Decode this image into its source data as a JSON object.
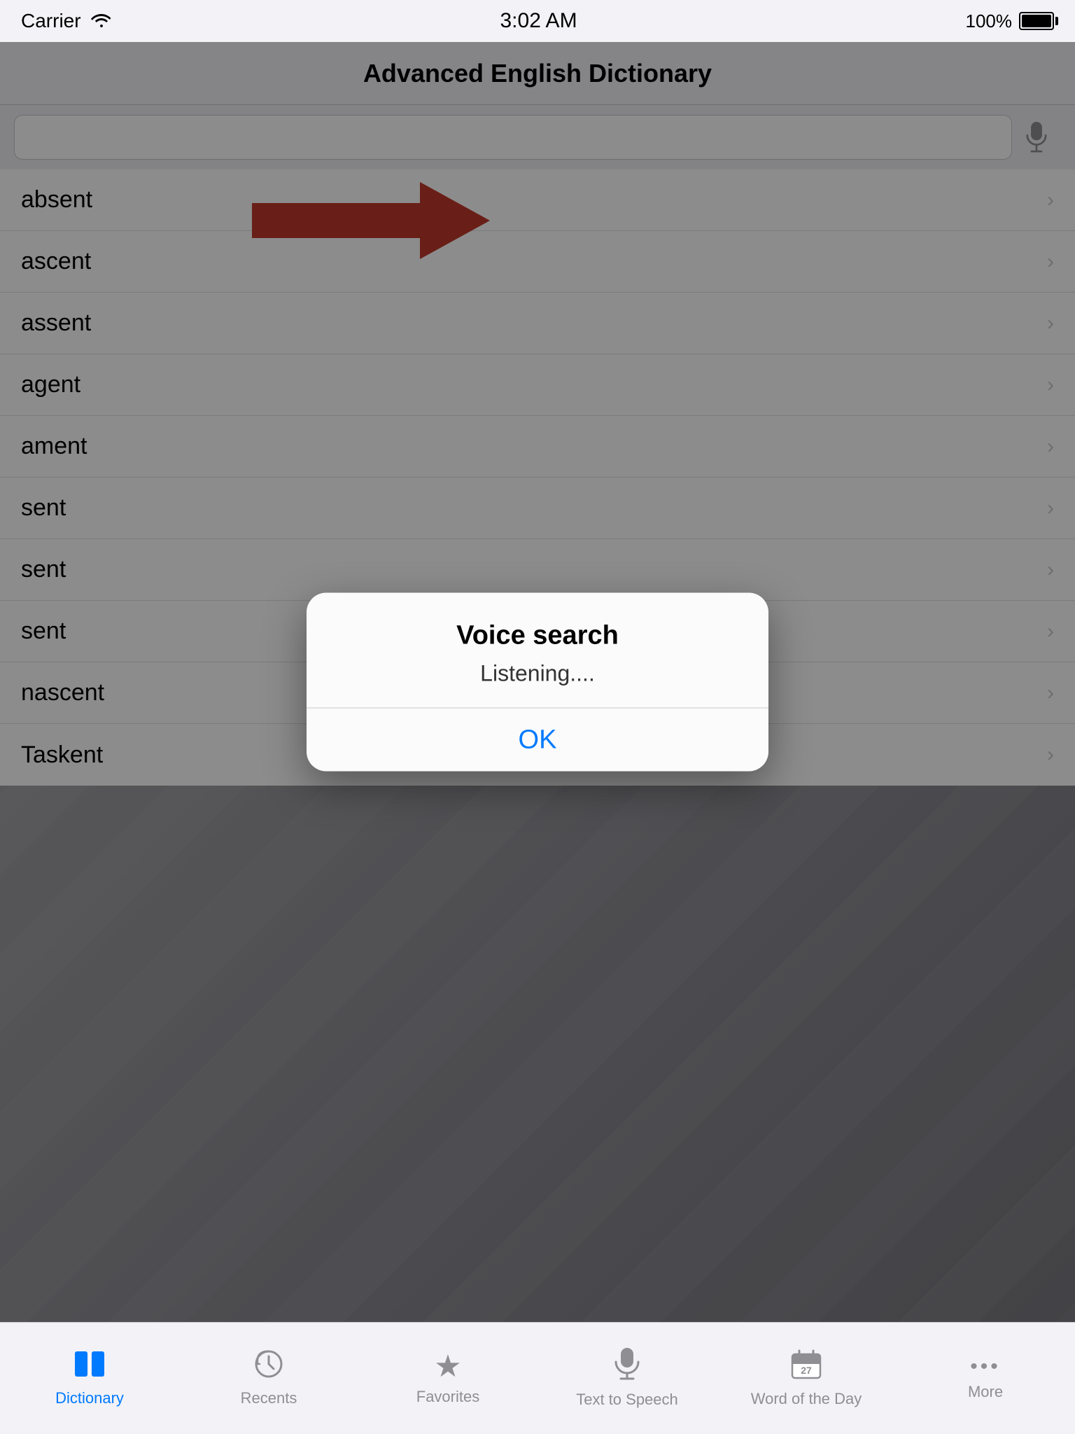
{
  "statusBar": {
    "carrier": "Carrier",
    "time": "3:02 AM",
    "battery": "100%"
  },
  "navBar": {
    "title": "Advanced English Dictionary"
  },
  "searchBar": {
    "placeholder": ""
  },
  "wordList": [
    {
      "word": "absent"
    },
    {
      "word": "ascent"
    },
    {
      "word": "assent"
    },
    {
      "word": "agent"
    },
    {
      "word": "ament"
    },
    {
      "word": "sent"
    },
    {
      "word": "sent"
    },
    {
      "word": "sent"
    },
    {
      "word": "nascent"
    },
    {
      "word": "Taskent"
    }
  ],
  "dialog": {
    "title": "Voice search",
    "message": "Listening....",
    "okLabel": "OK"
  },
  "tabBar": {
    "items": [
      {
        "id": "dictionary",
        "label": "Dictionary",
        "icon": "📖",
        "active": true
      },
      {
        "id": "recents",
        "label": "Recents",
        "icon": "⊙",
        "active": false
      },
      {
        "id": "favorites",
        "label": "Favorites",
        "icon": "★",
        "active": false
      },
      {
        "id": "tts",
        "label": "Text to Speech",
        "icon": "🎤",
        "active": false
      },
      {
        "id": "wotd",
        "label": "Word of the Day",
        "icon": "27",
        "active": false
      },
      {
        "id": "more",
        "label": "More",
        "icon": "•••",
        "active": false
      }
    ]
  },
  "redArrow": {
    "description": "red arrow pointing right toward microphone"
  }
}
